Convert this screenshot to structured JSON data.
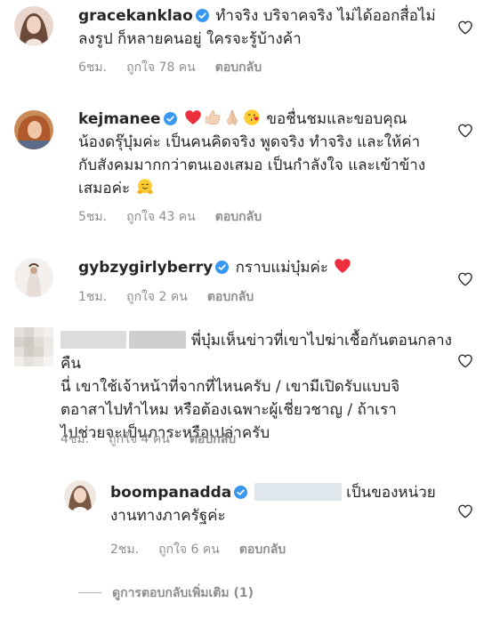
{
  "comments": [
    {
      "username": "gracekanklao",
      "verified": true,
      "text": "ทำจริง บริจาคจริง ไม่ได้ออกสื่อไม่ ลงรูป ก็หลายคนอยู่ ใครจะรู้บ้างค้า",
      "line1": "ทำจริง บริจาคจริง ไม่ได้ออกสื่อไม่",
      "line2": "ลงรูป ก็หลายคนอยู่ ใครจะรู้บ้างค้า",
      "time": "6ชม.",
      "likes": "ถูกใจ 78 คน",
      "reply": "ตอบกลับ"
    },
    {
      "username": "kejmanee",
      "verified": true,
      "emojis": [
        "red-heart",
        "thumbs-up",
        "folded-hands",
        "face-blowing-kiss"
      ],
      "line1": "ขอชื่นชมและขอบคุณ",
      "line2": "น้องดรุ๊บุ๋มค่ะ เป็นคนคิดจริง พูดจริง ทำจริง  และให้ค่า",
      "line3": "กับสังคมมากกว่าตนเองเสมอ เป็นกำลังใจ และเข้าข้าง",
      "line4": "เสมอค่ะ",
      "end_emoji": "hugging-face",
      "time": "5ชม.",
      "likes": "ถูกใจ 43 คน",
      "reply": "ตอบกลับ"
    },
    {
      "username": "gybzygirlyberry",
      "verified": true,
      "text": "กราบแม่บุ๋มค่ะ",
      "end_emoji": "red-heart",
      "time": "1ชม.",
      "likes": "ถูกใจ 2 คน",
      "reply": "ตอบกลับ"
    },
    {
      "username_hidden": true,
      "line1": "พี่บุ๋มเห็นข่าวที่เขาไปฆ่าเชื้อกันตอนกลางคืน",
      "line2": "นี่ เขาใช้เจ้าหน้าที่จากที่ไหนครับ / เขามีเปิดรับแบบจิ",
      "line3": "ตอาสาไปทำไหม หรือต้องเฉพาะผู้เชี่ยวชาญ / ถ้าเรา",
      "line4": "ไปช่วยจะเป็นภาระหรือเปล่าครับ",
      "time": "4ชม.",
      "likes": "ถูกใจ 4 คน",
      "reply": "ตอบกลับ"
    },
    {
      "username": "boompanadda",
      "verified": true,
      "mention_hidden": true,
      "line1": "เป็นของหน่วย",
      "line2": "งานทางภาครัฐค่ะ",
      "time": "2ชม.",
      "likes": "ถูกใจ 6 คน",
      "reply": "ตอบกลับ"
    }
  ],
  "view_more": "ดูการตอบกลับเพิ่มเติม (1)",
  "colors": {
    "text": "#262626",
    "meta": "#8e8e8e",
    "verified": "#3897f0",
    "heart_red": "#ed2e3f"
  }
}
